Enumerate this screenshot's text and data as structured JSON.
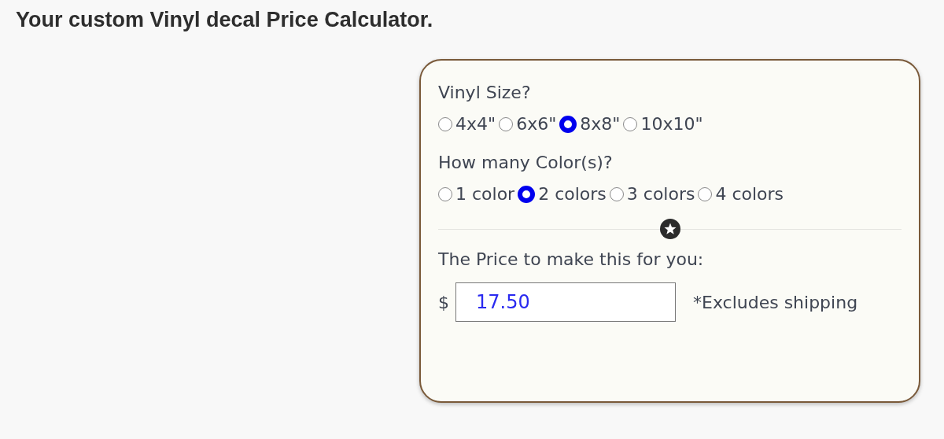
{
  "heading": "Your custom Vinyl decal Price Calculator.",
  "groups": [
    {
      "label": "Vinyl Size?",
      "options": [
        {
          "label": "4x4\"",
          "selected": false
        },
        {
          "label": "6x6\"",
          "selected": false
        },
        {
          "label": "8x8\"",
          "selected": true
        },
        {
          "label": "10x10\"",
          "selected": false
        }
      ]
    },
    {
      "label": "How many Color(s)?",
      "options": [
        {
          "label": "1 color",
          "selected": false
        },
        {
          "label": "2 colors",
          "selected": true
        },
        {
          "label": "3 colors",
          "selected": false
        },
        {
          "label": "4 colors",
          "selected": false
        }
      ]
    }
  ],
  "price": {
    "label": "The Price to make this for you:",
    "currency": "$",
    "value": "17.50",
    "note": "*Excludes shipping"
  }
}
